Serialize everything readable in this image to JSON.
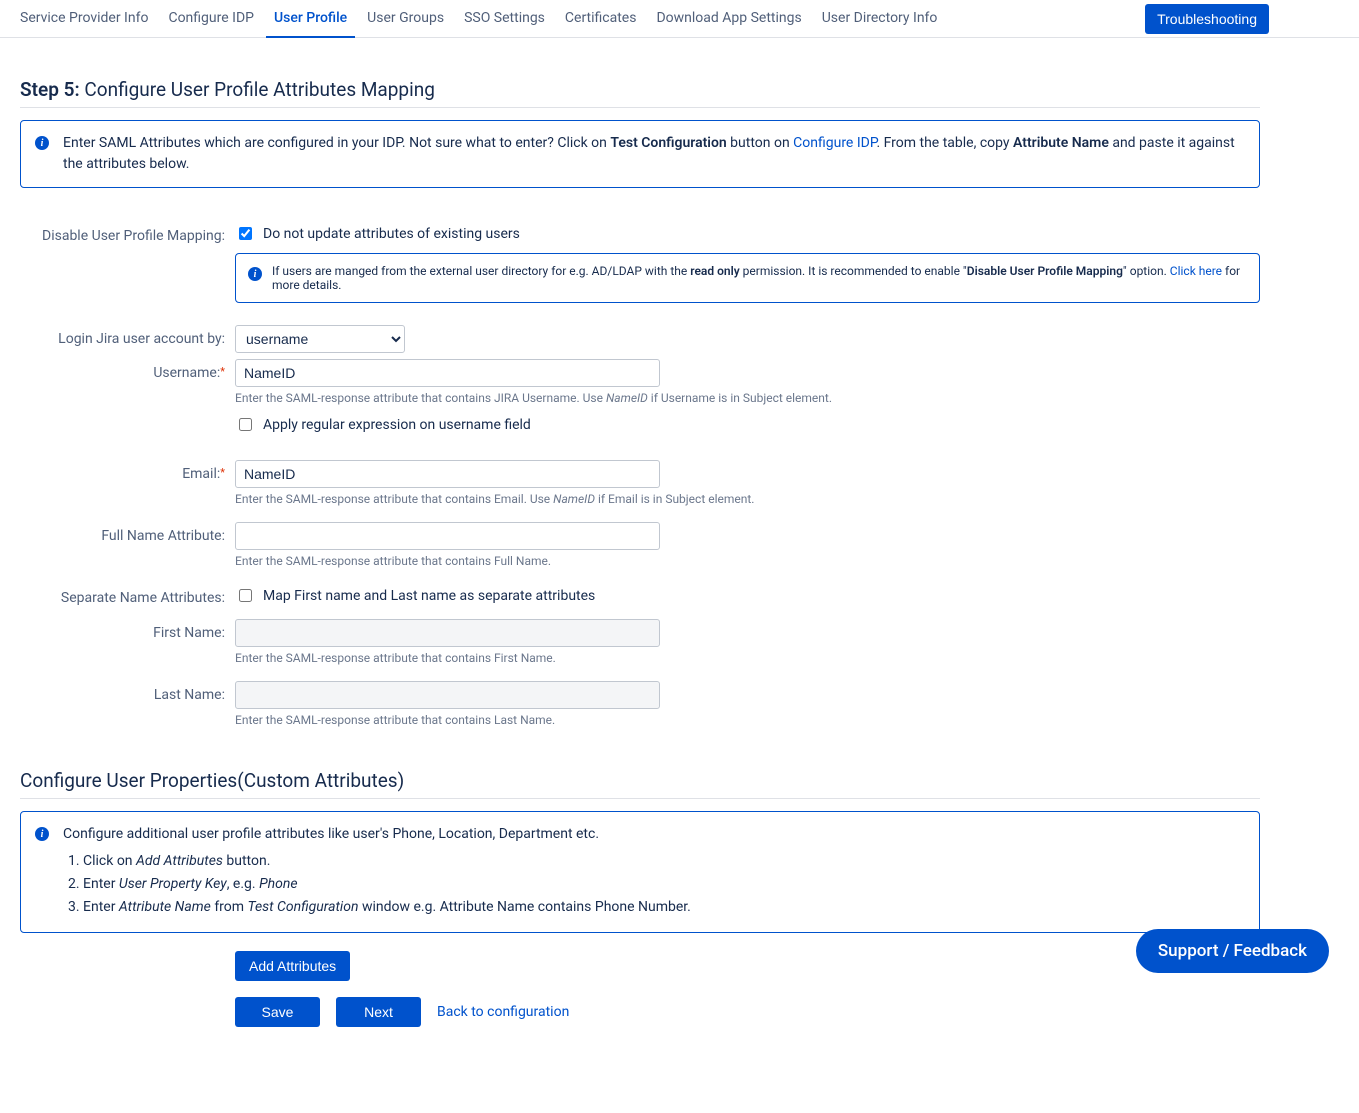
{
  "tabs": {
    "items": [
      {
        "label": "Service Provider Info"
      },
      {
        "label": "Configure IDP"
      },
      {
        "label": "User Profile"
      },
      {
        "label": "User Groups"
      },
      {
        "label": "SSO Settings"
      },
      {
        "label": "Certificates"
      },
      {
        "label": "Download App Settings"
      },
      {
        "label": "User Directory Info"
      }
    ],
    "active_index": 2,
    "troubleshooting": "Troubleshooting"
  },
  "step": {
    "prefix": "Step 5:",
    "title": " Configure User Profile Attributes Mapping"
  },
  "top_info": {
    "t1": "Enter SAML Attributes which are configured in your IDP. Not sure what to enter? Click on ",
    "b1": "Test Configuration",
    "t2": " button on ",
    "l1": "Configure IDP",
    "t3": ". From the table, copy ",
    "b2": "Attribute Name",
    "t4": " and paste it against the attributes below."
  },
  "form": {
    "disable_label": "Disable User Profile Mapping:",
    "disable_checkbox": "Do not update attributes of existing users",
    "disable_checked": true,
    "disable_info": {
      "t1": "If users are manged from the external user directory for e.g. AD/LDAP with the ",
      "b1": "read only",
      "t2": " permission. It is recommended to enable \"",
      "b2": "Disable User Profile Mapping",
      "t3": "\" option. ",
      "l1": "Click here",
      "t4": " for more details."
    },
    "login_by_label": "Login Jira user account by:",
    "login_by_value": "username",
    "username_label": "Username:",
    "username_value": "NameID",
    "username_help_t1": "Enter the SAML-response attribute that contains JIRA Username. Use ",
    "username_help_i1": "NameID",
    "username_help_t2": " if Username is in Subject element.",
    "regex_checkbox": " Apply regular expression on username field",
    "regex_checked": false,
    "email_label": "Email:",
    "email_value": "NameID",
    "email_help_t1": "Enter the SAML-response attribute that contains Email. Use ",
    "email_help_i1": "NameID",
    "email_help_t2": " if Email is in Subject element.",
    "fullname_label": "Full Name Attribute:",
    "fullname_value": "",
    "fullname_help": "Enter the SAML-response attribute that contains Full Name.",
    "separate_label": "Separate Name Attributes:",
    "separate_checkbox": " Map First name and Last name as separate attributes",
    "separate_checked": false,
    "firstname_label": "First Name:",
    "firstname_value": "",
    "firstname_help": "Enter the SAML-response attribute that contains First Name.",
    "lastname_label": "Last Name:",
    "lastname_value": "",
    "lastname_help": "Enter the SAML-response attribute that contains Last Name."
  },
  "custom": {
    "heading": "Configure User Properties(Custom Attributes)",
    "intro": "Configure additional user profile attributes like user's Phone, Location, Department etc.",
    "li1_t1": "Click on ",
    "li1_i1": "Add Attributes",
    "li1_t2": " button.",
    "li2_t1": "Enter ",
    "li2_i1": "User Property Key",
    "li2_t2": ", e.g. ",
    "li2_i2": "Phone",
    "li3_t1": "Enter ",
    "li3_i1": "Attribute Name",
    "li3_t2": " from ",
    "li3_i2": "Test Configuration",
    "li3_t3": " window e.g. Attribute Name contains Phone Number.",
    "add_btn": "Add Attributes"
  },
  "buttons": {
    "save": "Save",
    "next": "Next",
    "back": "Back to configuration"
  },
  "support": "Support / Feedback"
}
